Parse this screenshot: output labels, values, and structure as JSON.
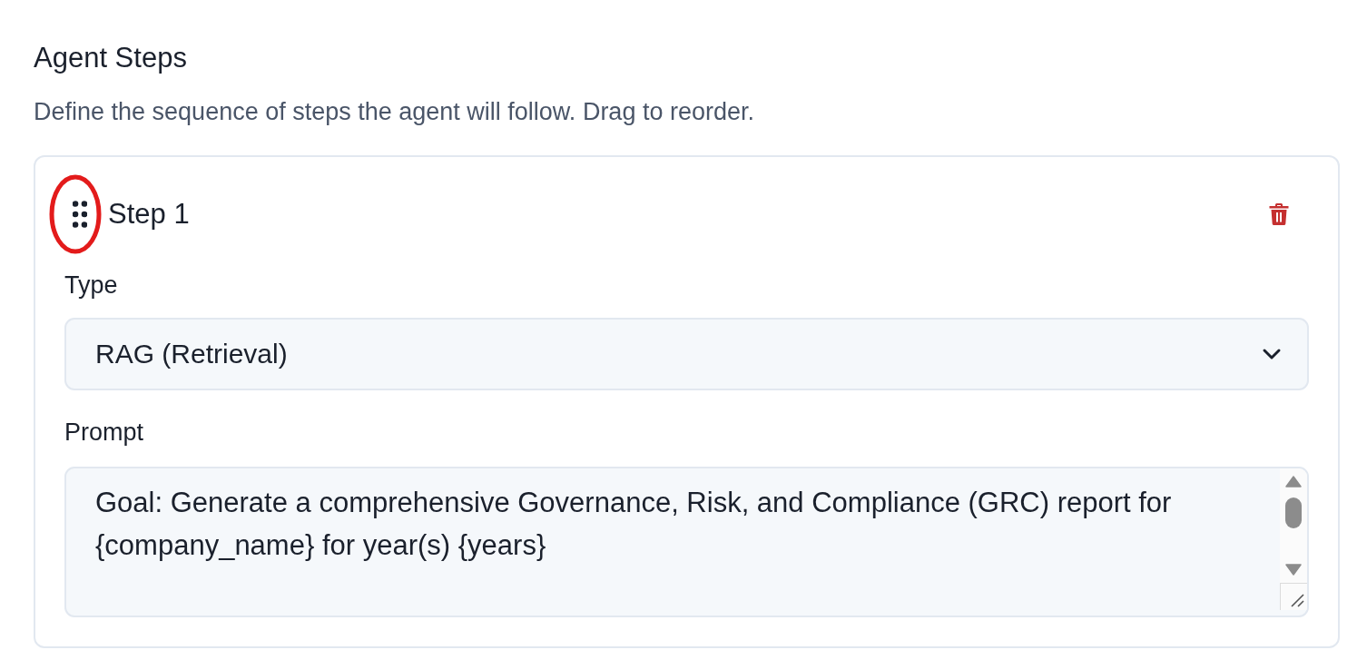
{
  "section": {
    "title": "Agent Steps",
    "description": "Define the sequence of steps the agent will follow. Drag to reorder."
  },
  "steps": [
    {
      "title": "Step 1",
      "handle_highlighted": true,
      "fields": [
        {
          "kind": "select",
          "label": "Type",
          "value": "RAG (Retrieval)"
        },
        {
          "kind": "textarea",
          "label": "Prompt",
          "value": "Goal: Generate a comprehensive Governance, Risk, and Compliance (GRC) report for {company_name} for year(s) {years}"
        }
      ]
    }
  ]
}
